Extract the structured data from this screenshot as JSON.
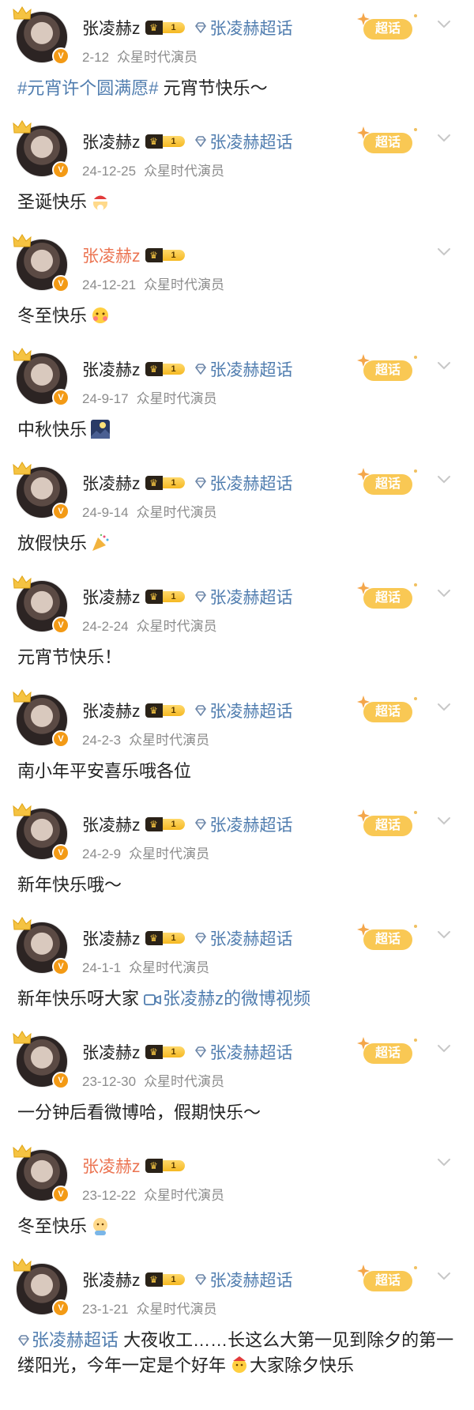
{
  "posts": [
    {
      "name": "张凌赫z",
      "name_orange": false,
      "level": "1",
      "topic": "张凌赫超话",
      "date": "2-12",
      "source": "众星时代演员",
      "badge": "超话",
      "hashtag": "#元宵许个圆满愿#",
      "text": " 元宵节快乐～",
      "emoji": "",
      "link": ""
    },
    {
      "name": "张凌赫z",
      "name_orange": false,
      "level": "1",
      "topic": "张凌赫超话",
      "date": "24-12-25",
      "source": "众星时代演员",
      "badge": "超话",
      "hashtag": "",
      "text": "圣诞快乐",
      "emoji": "santa-emoji",
      "link": ""
    },
    {
      "name": "张凌赫z",
      "name_orange": true,
      "level": "1",
      "topic": "",
      "date": "24-12-21",
      "source": "众星时代演员",
      "badge": "",
      "hashtag": "",
      "text": "冬至快乐",
      "emoji": "hug-emoji",
      "link": ""
    },
    {
      "name": "张凌赫z",
      "name_orange": false,
      "level": "1",
      "topic": "张凌赫超话",
      "date": "24-9-17",
      "source": "众星时代演员",
      "badge": "超话",
      "hashtag": "",
      "text": "中秋快乐",
      "emoji": "moon-night-emoji",
      "link": ""
    },
    {
      "name": "张凌赫z",
      "name_orange": false,
      "level": "1",
      "topic": "张凌赫超话",
      "date": "24-9-14",
      "source": "众星时代演员",
      "badge": "超话",
      "hashtag": "",
      "text": "放假快乐",
      "emoji": "party-popper-emoji",
      "link": ""
    },
    {
      "name": "张凌赫z",
      "name_orange": false,
      "level": "1",
      "topic": "张凌赫超话",
      "date": "24-2-24",
      "source": "众星时代演员",
      "badge": "超话",
      "hashtag": "",
      "text": "元宵节快乐！",
      "emoji": "",
      "link": ""
    },
    {
      "name": "张凌赫z",
      "name_orange": false,
      "level": "1",
      "topic": "张凌赫超话",
      "date": "24-2-3",
      "source": "众星时代演员",
      "badge": "超话",
      "hashtag": "",
      "text": "南小年平安喜乐哦各位",
      "emoji": "",
      "link": ""
    },
    {
      "name": "张凌赫z",
      "name_orange": false,
      "level": "1",
      "topic": "张凌赫超话",
      "date": "24-2-9",
      "source": "众星时代演员",
      "badge": "超话",
      "hashtag": "",
      "text": "新年快乐哦～",
      "emoji": "",
      "link": ""
    },
    {
      "name": "张凌赫z",
      "name_orange": false,
      "level": "1",
      "topic": "张凌赫超话",
      "date": "24-1-1",
      "source": "众星时代演员",
      "badge": "超话",
      "hashtag": "",
      "text": "新年快乐呀大家 ",
      "emoji": "",
      "link": "张凌赫z的微博视频"
    },
    {
      "name": "张凌赫z",
      "name_orange": false,
      "level": "1",
      "topic": "张凌赫超话",
      "date": "23-12-30",
      "source": "众星时代演员",
      "badge": "超话",
      "hashtag": "",
      "text": "一分钟后看微博哈，假期快乐～",
      "emoji": "",
      "link": ""
    },
    {
      "name": "张凌赫z",
      "name_orange": true,
      "level": "1",
      "topic": "",
      "date": "23-12-22",
      "source": "众星时代演员",
      "badge": "",
      "hashtag": "",
      "text": "冬至快乐",
      "emoji": "baby-emoji",
      "link": ""
    },
    {
      "name": "张凌赫z",
      "name_orange": false,
      "level": "1",
      "topic": "张凌赫超话",
      "date": "23-1-21",
      "source": "众星时代演员",
      "badge": "超话",
      "hashtag": "",
      "text": "",
      "emoji": "",
      "link": "",
      "last_topic": "张凌赫超话",
      "last_text_1": " 大夜收工……长这么大第一见到除夕的第一缕阳光，今年一定是个好年",
      "last_text_2": "大家除夕快乐"
    }
  ],
  "colors": {
    "link": "#507daf",
    "orange_name": "#eb7350",
    "badge": "#f9c854"
  }
}
